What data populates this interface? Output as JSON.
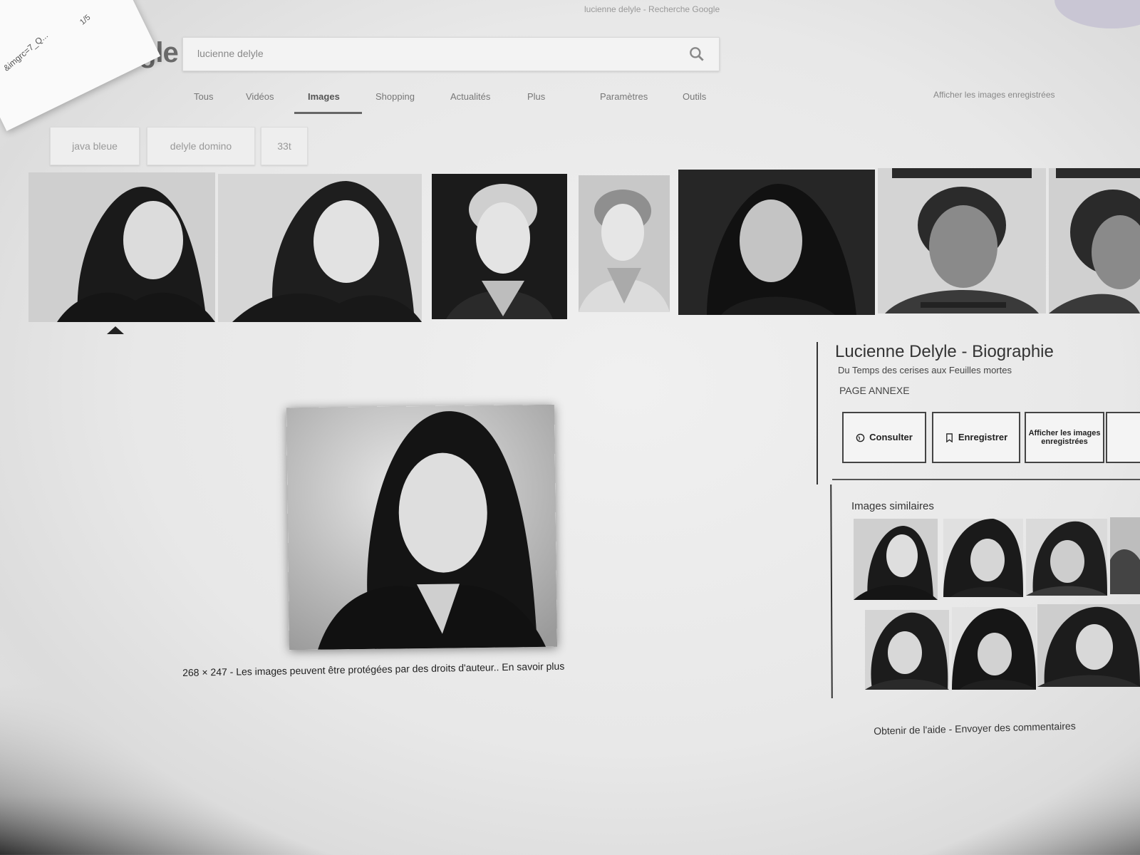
{
  "browser": {
    "title": "lucienne delyle - Recherche Google"
  },
  "paper_note": {
    "text": "&imgrc=7_Q...",
    "count": "1/5"
  },
  "header": {
    "logo_text": "Google",
    "search": {
      "value": "lucienne delyle",
      "icon": "search-icon"
    }
  },
  "tabs": [
    {
      "label": "Tous"
    },
    {
      "label": "Vidéos"
    },
    {
      "label": "Images",
      "active": true
    },
    {
      "label": "Shopping"
    },
    {
      "label": "Actualités"
    },
    {
      "label": "Plus"
    },
    {
      "label": "Paramètres"
    },
    {
      "label": "Outils"
    }
  ],
  "right_link": "Afficher les images enregistrées",
  "chips": [
    {
      "label": "java bleue"
    },
    {
      "label": "delyle domino"
    },
    {
      "label": "33t"
    }
  ],
  "viewer": {
    "caption_size": "268 × 247",
    "caption_text": " - Les images peuvent être protégées par des droits d'auteur.. ",
    "caption_link": "En savoir plus"
  },
  "panel": {
    "title": "Lucienne Delyle - Biographie",
    "subtitle": "Du Temps des cerises aux Feuilles mortes",
    "domain": "PAGE ANNEXE",
    "buttons": [
      {
        "label": "Consulter",
        "icon": "globe-icon"
      },
      {
        "label": "Enregistrer",
        "icon": "bookmark-icon"
      },
      {
        "label": "Afficher les images enregistrées",
        "icon": ""
      }
    ],
    "similar_label": "Images similaires"
  },
  "footer": {
    "help": "Obtenir de l'aide",
    "separator": " - ",
    "feedback": "Envoyer des commentaires"
  }
}
